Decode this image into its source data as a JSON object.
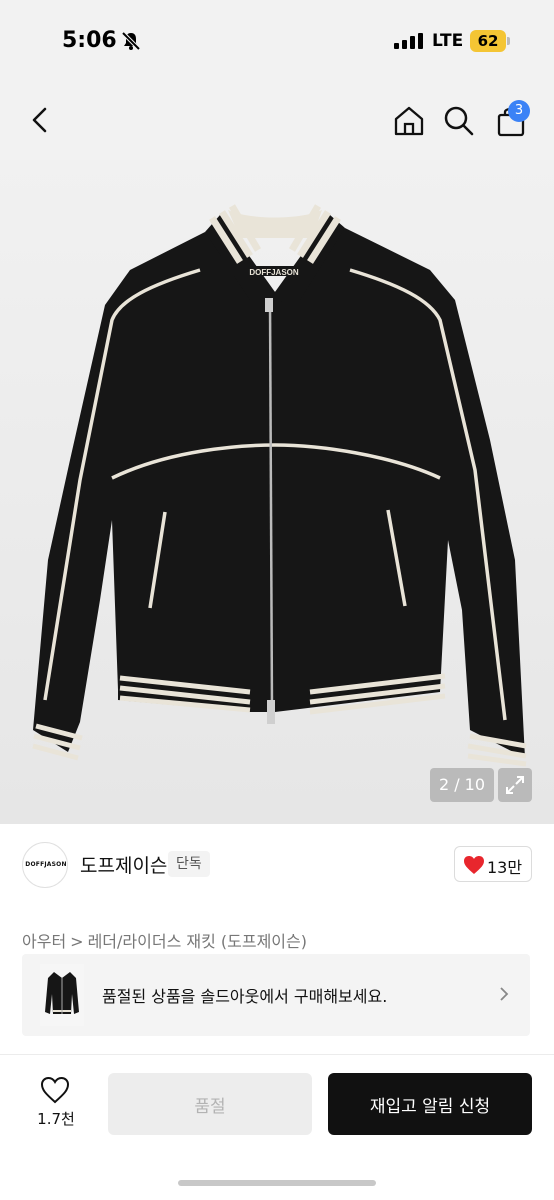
{
  "status_bar": {
    "time": "5:06",
    "network": "LTE",
    "battery": "62"
  },
  "header": {
    "cart_count": "3"
  },
  "gallery": {
    "counter": "2 / 10",
    "garment_logo_text": "DOFFJASON"
  },
  "brand": {
    "logo_text": "DOFFJASON",
    "name": "도프제이슨",
    "badge": "단독",
    "likes": "13만"
  },
  "breadcrumb": {
    "level1": "아우터",
    "separator": ">",
    "level2": "레더/라이더스 재킷 (도프제이슨)"
  },
  "soldout_notice": {
    "text": "품절된 상품을 솔드아웃에서 구매해보세요."
  },
  "bottom_bar": {
    "wish_count": "1.7천",
    "soldout_label": "품절",
    "restock_label": "재입고 알림 신청"
  },
  "colors": {
    "accent_badge": "#3b82f6",
    "battery": "#f4c534",
    "like_heart": "#e8262d",
    "primary_button": "#111111",
    "disabled_button": "#ededed"
  }
}
